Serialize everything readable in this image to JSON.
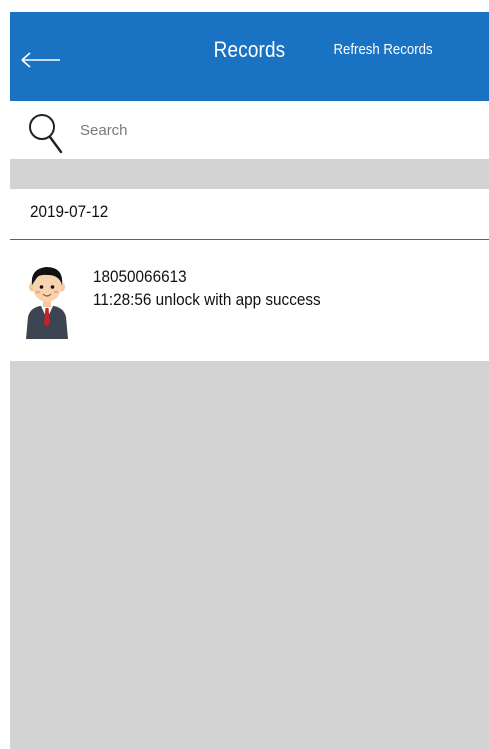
{
  "header": {
    "title": "Records",
    "refresh_label": "Refresh Records",
    "back_icon": "arrow-left-icon",
    "background": "#1a72c2"
  },
  "search": {
    "placeholder": "Search",
    "value": "",
    "icon": "search-icon"
  },
  "records": {
    "date": "2019-07-12",
    "items": [
      {
        "avatar_icon": "user-avatar-icon",
        "phone": "18050066613",
        "detail": "11:28:56 unlock with app success"
      }
    ]
  }
}
